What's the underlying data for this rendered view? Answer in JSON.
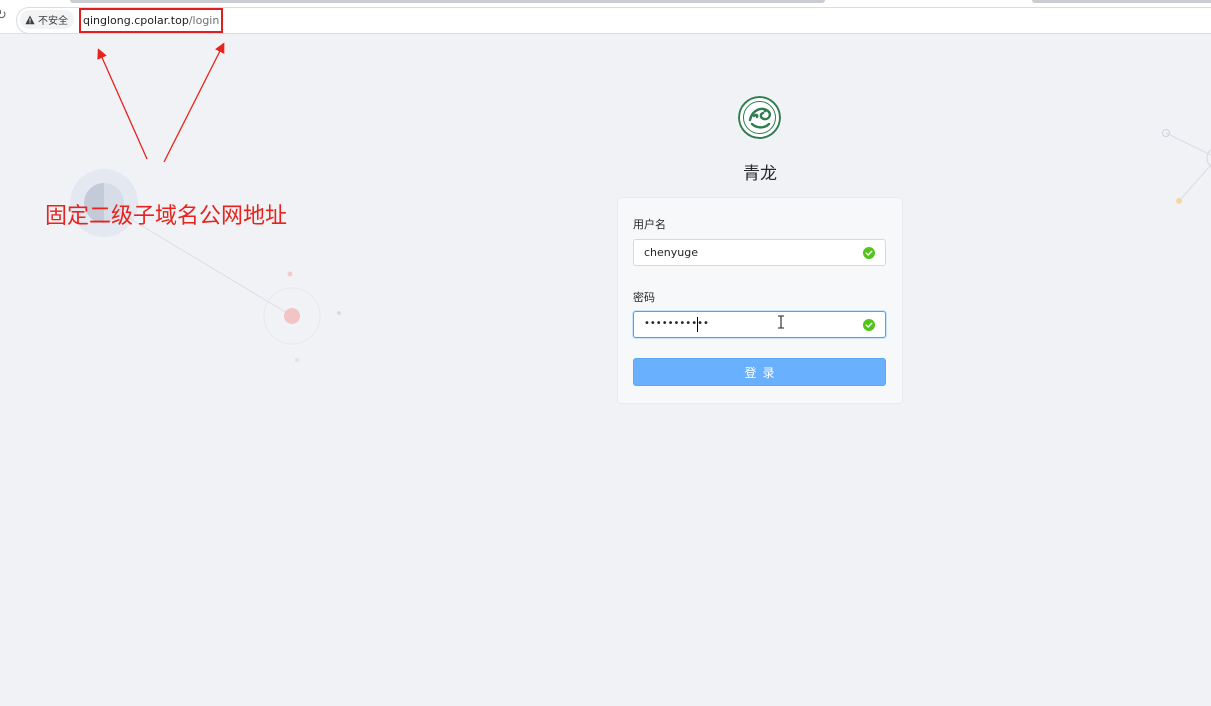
{
  "browser": {
    "security_label": "不安全",
    "url_host": "qinglong.cpolar.top",
    "url_path": "/login"
  },
  "annotation": {
    "text": "固定二级子域名公网地址",
    "color": "#e8231d"
  },
  "app": {
    "title": "青龙",
    "logo_icon": "dragon-logo-icon"
  },
  "form": {
    "username_label": "用户名",
    "username_value": "chenyuge",
    "password_label": "密码",
    "password_value": "•••••••••••",
    "submit_label": "登录"
  },
  "colors": {
    "primary": "#69b1ff",
    "success": "#52c41a",
    "background": "#f0f2f5"
  }
}
